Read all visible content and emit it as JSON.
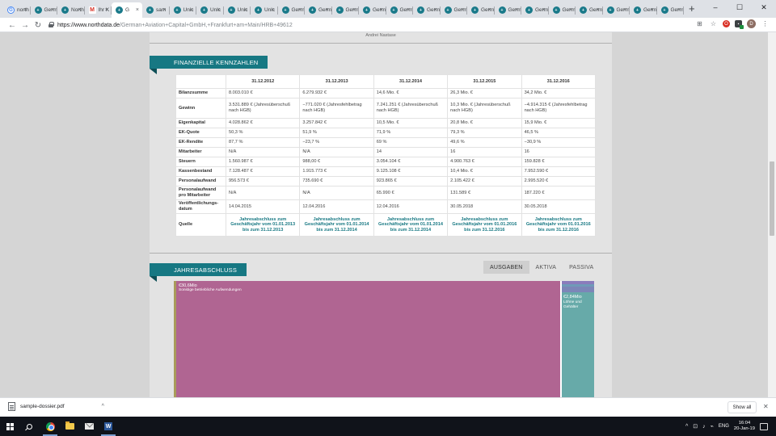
{
  "browser": {
    "tabs": [
      {
        "label": "north",
        "favicon": "G"
      },
      {
        "label": "Germ",
        "favicon": "nd"
      },
      {
        "label": "North",
        "favicon": "nd"
      },
      {
        "label": "Ihr K",
        "favicon": "M"
      },
      {
        "label": "G",
        "favicon": "nd",
        "active": true
      },
      {
        "label": "sam",
        "favicon": "nd"
      },
      {
        "label": "Unic",
        "favicon": "nd"
      },
      {
        "label": "Unic",
        "favicon": "nd"
      },
      {
        "label": "Unic",
        "favicon": "nd"
      },
      {
        "label": "Unic",
        "favicon": "nd"
      },
      {
        "label": "Germ",
        "favicon": "nd"
      },
      {
        "label": "Germ",
        "favicon": "nd"
      },
      {
        "label": "Germ",
        "favicon": "nd"
      },
      {
        "label": "Germ",
        "favicon": "nd"
      },
      {
        "label": "Germ",
        "favicon": "nd"
      },
      {
        "label": "Germ",
        "favicon": "nd"
      },
      {
        "label": "Germ",
        "favicon": "nd"
      },
      {
        "label": "Germ",
        "favicon": "nd"
      },
      {
        "label": "Germ",
        "favicon": "nd"
      },
      {
        "label": "Germ",
        "favicon": "nd"
      },
      {
        "label": "Germ",
        "favicon": "nd"
      },
      {
        "label": "Germ",
        "favicon": "nd"
      },
      {
        "label": "Germ",
        "favicon": "nd"
      },
      {
        "label": "Germ",
        "favicon": "nd"
      },
      {
        "label": "Germ",
        "favicon": "nd"
      }
    ],
    "new_tab": "+",
    "window_controls": {
      "minimize": "–",
      "maximize": "☐",
      "close": "✕"
    },
    "nav": {
      "back": "←",
      "forward": "→",
      "reload": "↻"
    },
    "url_host": "https://www.northdata.de",
    "url_path": "/German+Aviation+Capital+GmbH,+Frankfurt+am+Main/HRB+49612",
    "ext_red": "O",
    "ext_dark": "▪",
    "avatar": "D",
    "translate_icon": "⊞",
    "star_icon": "☆",
    "menu_icon": "⋮"
  },
  "page": {
    "byline": "Andrei Nastase",
    "kennzahlen": {
      "title": "FINANZIELLE KENNZAHLEN",
      "years": [
        "31.12.2012",
        "31.12.2013",
        "31.12.2014",
        "31.12.2015",
        "31.12.2016"
      ],
      "rows": [
        {
          "label": "Bilanzsumme",
          "cells": [
            "8.003.010 €",
            "6.279.932 €",
            "14,6 Mio. €",
            "26,3 Mio. €",
            "34,2 Mio. €"
          ]
        },
        {
          "label": "Gewinn",
          "cells": [
            "3.531.889 € (Jahresüberschuß nach HGB)",
            "−771.020 € (Jahresfehlbetrag nach HGB)",
            "7.241.251 € (Jahresüberschuß nach HGB)",
            "10,3 Mio. € (Jahresüberschuß nach HGB)",
            "−4.914.315 € (Jahresfehlbetrag nach HGB)"
          ]
        },
        {
          "label": "Eigenkapital",
          "cells": [
            "4.028.862 €",
            "3.257.842 €",
            "10,5 Mio. €",
            "20,8 Mio. €",
            "15,9 Mio. €"
          ]
        },
        {
          "label": "EK-Quote",
          "cells": [
            "50,3 %",
            "51,9 %",
            "71,9 %",
            "79,3 %",
            "46,5 %"
          ]
        },
        {
          "label": "EK-Rendite",
          "cells": [
            "87,7 %",
            "−23,7 %",
            "69 %",
            "49,6 %",
            "−30,9 %"
          ]
        },
        {
          "label": "Mitarbeiter",
          "cells": [
            "N/A",
            "N/A",
            "14",
            "16",
            "16"
          ]
        },
        {
          "label": "Steuern",
          "cells": [
            "1.560.987 €",
            "988,00 €",
            "3.054.104 €",
            "4.900.763 €",
            "159.828 €"
          ]
        },
        {
          "label": "Kassenbestand",
          "cells": [
            "7.128.487 €",
            "1.915.773 €",
            "9.125.108 €",
            "10,4 Mio. €",
            "7.952.590 €"
          ]
        },
        {
          "label": "Personalaufwand",
          "cells": [
            "956.573 €",
            "735.690 €",
            "923.865 €",
            "2.105.422 €",
            "2.995.520 €"
          ]
        },
        {
          "label": "Personalaufwand pro Mitarbeiter",
          "cells": [
            "N/A",
            "N/A",
            "65.990 €",
            "131.589 €",
            "187.220 €"
          ]
        },
        {
          "label": "Veröffentlichungs-datum",
          "cells": [
            "14.04.2015",
            "12.04.2016",
            "12.04.2016",
            "30.05.2018",
            "30.05.2018"
          ]
        },
        {
          "label": "Quelle",
          "cells": [
            "Jahresabschluss zum Geschäftsjahr vom 01.01.2013 bis zum 31.12.2013",
            "Jahresabschluss zum Geschäftsjahr vom 01.01.2014 bis zum 31.12.2014",
            "Jahresabschluss zum Geschäftsjahr vom 01.01.2014 bis zum 31.12.2014",
            "Jahresabschluss zum Geschäftsjahr vom 01.01.2016 bis zum 31.12.2016",
            "Jahresabschluss zum Geschäftsjahr vom 01.01.2016 bis zum 31.12.2016"
          ]
        }
      ]
    },
    "jahresabschluss": {
      "title": "JAHRESABSCHLUSS",
      "tabs": [
        "AUSGABEN",
        "AKTIVA",
        "PASSIVA"
      ],
      "selected_tab": "AUSGABEN",
      "treemap": {
        "main_value": "€30,6Mio",
        "main_label": "Sonstige betriebliche Aufwendungen",
        "side_value": "€2,84Mio",
        "side_label": "Löhne und Gehälter"
      }
    }
  },
  "downloads": {
    "file": "sample-dossier.pdf",
    "chevron": "^",
    "show_all": "Show all",
    "close": "✕"
  },
  "taskbar": {
    "lang": "ENG",
    "time": "16:04",
    "date": "20-Jan-19",
    "tray_icons": [
      "^",
      "⊡",
      "♪",
      "⌁"
    ]
  },
  "colors": {
    "accent": "#177883",
    "treemap_main": "#b06592",
    "treemap_side": "#67aaa9"
  }
}
